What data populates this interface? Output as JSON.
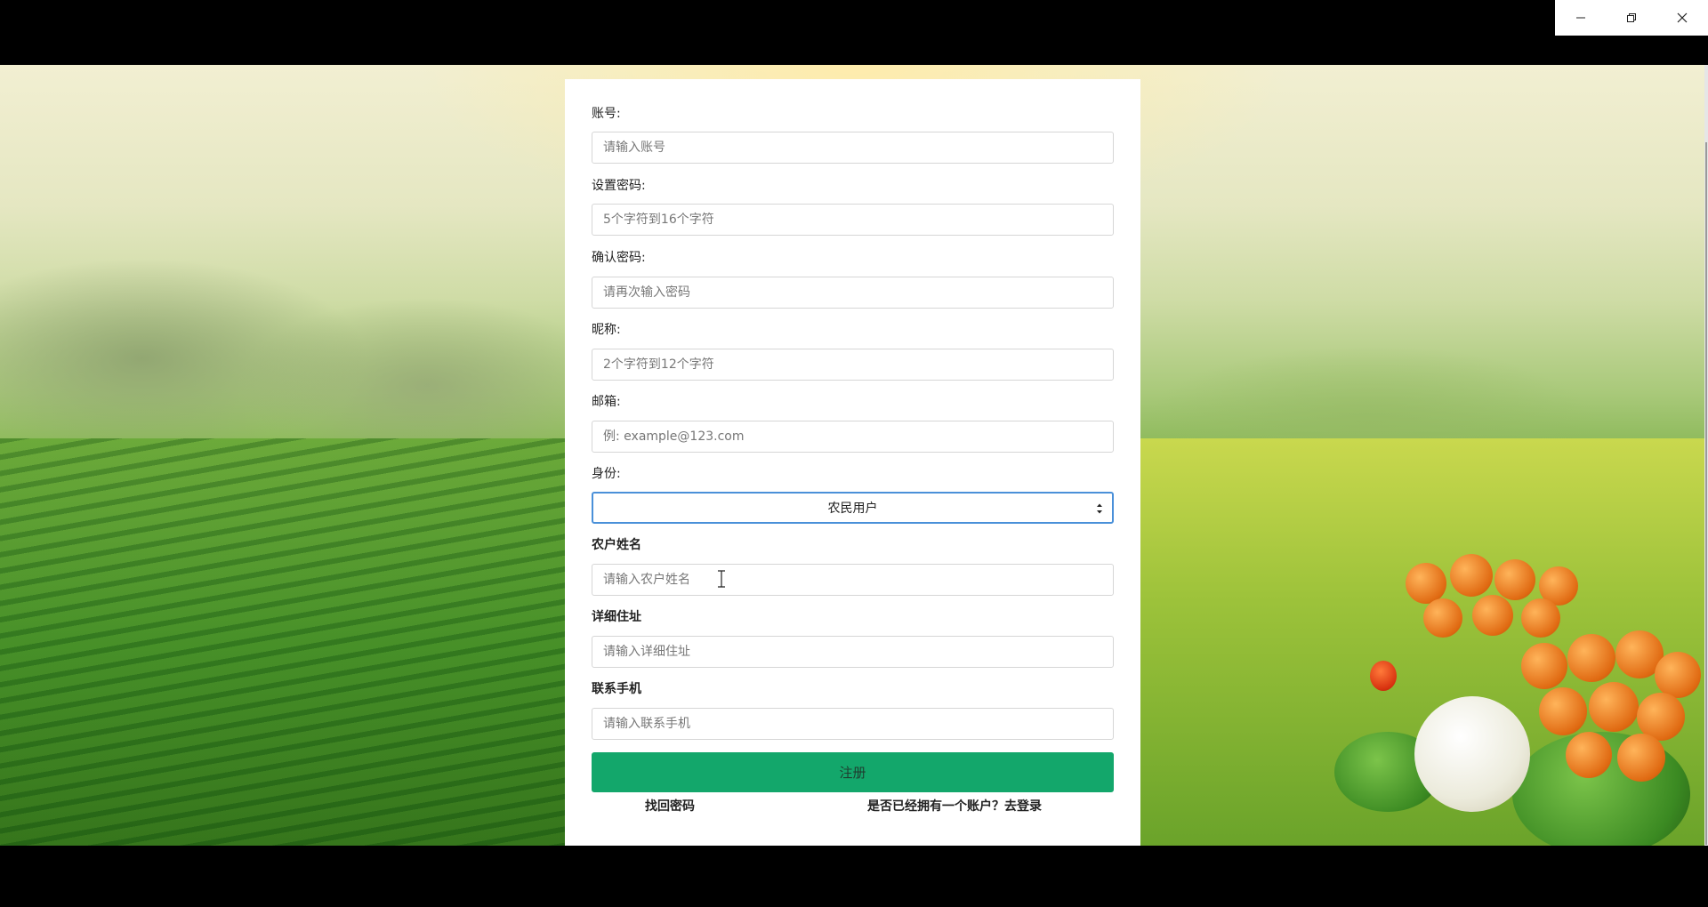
{
  "window": {
    "controls": {
      "minimize_icon": "minimize-icon",
      "restore_icon": "restore-icon",
      "close_icon": "close-icon"
    }
  },
  "form": {
    "account": {
      "label": "账号:",
      "placeholder": "请输入账号"
    },
    "password": {
      "label": "设置密码:",
      "placeholder": "5个字符到16个字符"
    },
    "confirm_password": {
      "label": "确认密码:",
      "placeholder": "请再次输入密码"
    },
    "nickname": {
      "label": "昵称:",
      "placeholder": "2个字符到12个字符"
    },
    "email": {
      "label": "邮箱:",
      "placeholder": "例: example@123.com"
    },
    "identity": {
      "label": "身份:",
      "selected": "农民用户"
    },
    "farmer_name": {
      "label": "农户姓名",
      "placeholder": "请输入农户姓名"
    },
    "address": {
      "label": "详细住址",
      "placeholder": "请输入详细住址"
    },
    "phone": {
      "label": "联系手机",
      "placeholder": "请输入联系手机"
    },
    "submit_label": "注册",
    "forgot_password": "找回密码",
    "login_prompt": "是否已经拥有一个账户？去登录"
  },
  "colors": {
    "submit_button": "#13a76b",
    "select_focus_border": "#4a90d9"
  }
}
